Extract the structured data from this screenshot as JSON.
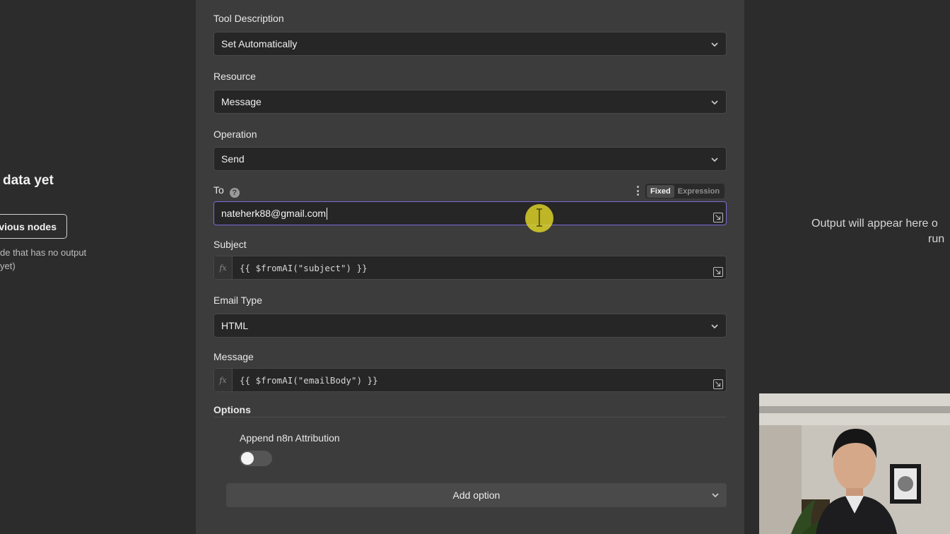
{
  "left_panel": {
    "title": "data yet",
    "button_label": "vious nodes",
    "hint_line1": "de that has no output",
    "hint_line2": " yet)"
  },
  "fields": {
    "tool_description": {
      "label": "Tool Description",
      "value": "Set Automatically"
    },
    "resource": {
      "label": "Resource",
      "value": "Message"
    },
    "operation": {
      "label": "Operation",
      "value": "Send"
    },
    "to": {
      "label": "To",
      "help_icon": "?",
      "value": "nateherk88@gmail.com",
      "mode_fixed": "Fixed",
      "mode_expression": "Expression"
    },
    "subject": {
      "label": "Subject",
      "fx": "fx",
      "value": "{{ $fromAI(\"subject\") }}"
    },
    "email_type": {
      "label": "Email Type",
      "value": "HTML"
    },
    "message": {
      "label": "Message",
      "fx": "fx",
      "value": "{{ $fromAI(\"emailBody\") }}"
    }
  },
  "options": {
    "heading": "Options",
    "append_attribution_label": "Append n8n Attribution",
    "append_attribution_enabled": false,
    "add_option_label": "Add option"
  },
  "right_panel": {
    "line1": "Output will appear here o",
    "line2": "run"
  },
  "colors": {
    "panel_bg": "#3c3c3c",
    "input_bg": "#262626",
    "focus_border": "#7b6bd6",
    "cursor_highlight": "#e1d728"
  }
}
